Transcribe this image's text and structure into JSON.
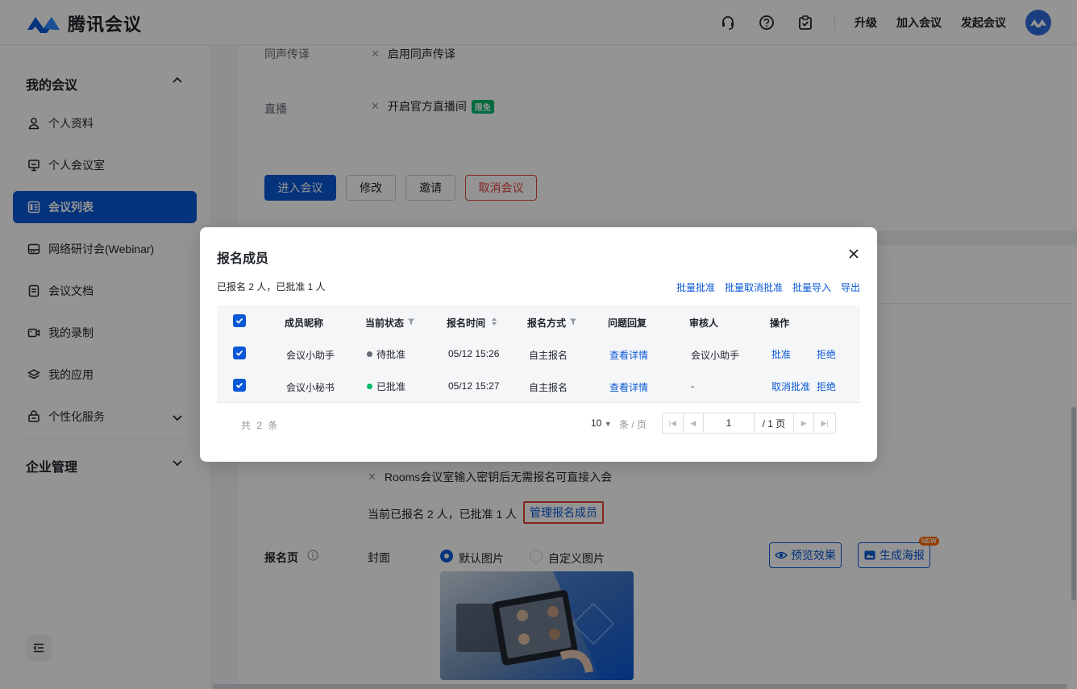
{
  "app": {
    "name": "腾讯会议"
  },
  "header": {
    "links": [
      "升级",
      "加入会议",
      "发起会议"
    ],
    "icons": [
      "headset-icon",
      "help-icon",
      "task-check-icon"
    ]
  },
  "sidebar": {
    "group_meetings": "我的会议",
    "items": [
      {
        "label": "个人资料",
        "icon": "user-icon"
      },
      {
        "label": "个人会议室",
        "icon": "presentation-icon"
      },
      {
        "label": "会议列表",
        "icon": "list-icon",
        "active": true
      },
      {
        "label": "网络研讨会(Webinar)",
        "icon": "webinar-icon"
      },
      {
        "label": "会议文档",
        "icon": "document-icon"
      },
      {
        "label": "我的录制",
        "icon": "video-icon"
      },
      {
        "label": "我的应用",
        "icon": "layers-icon"
      },
      {
        "label": "个性化服务",
        "icon": "gift-icon"
      }
    ],
    "group_enterprise": "企业管理"
  },
  "detail": {
    "rows": [
      {
        "label": "同声传译",
        "value": "启用同声传译"
      },
      {
        "label": "直播",
        "value": "开启官方直播间",
        "badge": "限免"
      }
    ],
    "buttons": {
      "enter": "进入会议",
      "edit": "修改",
      "invite": "邀请",
      "cancel": "取消会议"
    },
    "rooms_note": "Rooms会议室输入密钥后无需报名可直接入会",
    "registration_summary": "当前已报名 2 人，已批准 1 人",
    "manage_link": "管理报名成员",
    "reg_page_label": "报名页",
    "cover_label": "封面",
    "cover_options": [
      "默认图片",
      "自定义图片"
    ],
    "preview_button": "预览效果",
    "poster_button": "生成海报",
    "new_badge": "NEW"
  },
  "modal": {
    "title": "报名成员",
    "summary": "已报名 2 人，已批准 1 人",
    "bulk_actions": [
      "批量批准",
      "批量取消批准",
      "批量导入",
      "导出"
    ],
    "columns": [
      "成员昵称",
      "当前状态",
      "报名时间",
      "报名方式",
      "问题回复",
      "审核人",
      "操作"
    ],
    "rows": [
      {
        "name": "会议小助手",
        "status": "待批准",
        "status_color": "#646a73",
        "time": "05/12 15:26",
        "method": "自主报名",
        "reply": "查看详情",
        "reviewer": "会议小助手",
        "action1": "批准",
        "action2": "拒绝"
      },
      {
        "name": "会议小秘书",
        "status": "已批准",
        "status_color": "#00b86b",
        "time": "05/12 15:27",
        "method": "自主报名",
        "reply": "查看详情",
        "reviewer": "-",
        "action1": "取消批准",
        "action2": "拒绝"
      }
    ],
    "footer": {
      "total": "共 2 条",
      "page_size": "10",
      "page_unit": "条 / 页",
      "page": "1",
      "page_total": "/ 1 页"
    }
  },
  "colors": {
    "brand": "#0a58d6",
    "danger": "#e0423a",
    "success": "#00b86b"
  }
}
